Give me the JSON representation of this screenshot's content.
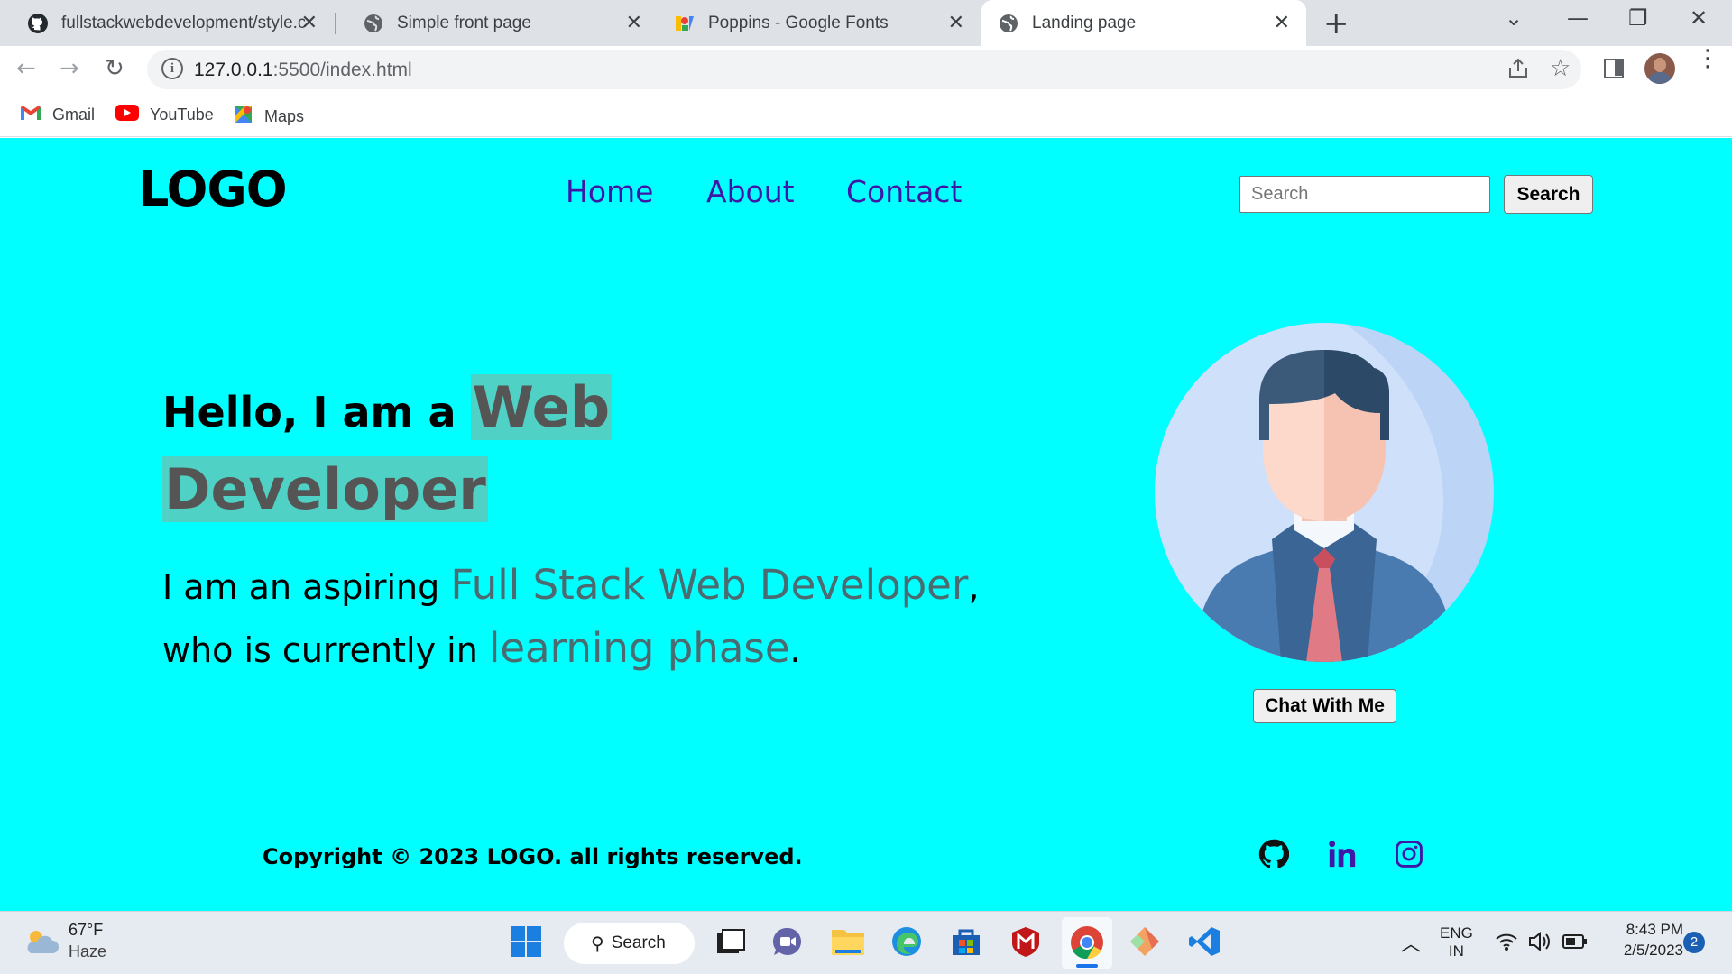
{
  "browser": {
    "tabs": [
      {
        "title": "fullstackwebdevelopment/style.c",
        "icon": "github-icon"
      },
      {
        "title": "Simple front page",
        "icon": "globe-icon"
      },
      {
        "title": "Poppins - Google Fonts",
        "icon": "google-fonts-icon"
      },
      {
        "title": "Landing page",
        "icon": "globe-icon",
        "active": true
      }
    ],
    "url_host": "127.0.0.1",
    "url_rest": ":5500/index.html",
    "bookmarks": [
      {
        "label": "Gmail",
        "icon": "gmail-icon"
      },
      {
        "label": "YouTube",
        "icon": "youtube-icon"
      },
      {
        "label": "Maps",
        "icon": "maps-icon"
      }
    ]
  },
  "site": {
    "logo": "LOGO",
    "nav": [
      "Home",
      "About",
      "Contact"
    ],
    "search_placeholder": "Search",
    "search_button": "Search",
    "hero": {
      "prefix": "Hello, I am a ",
      "highlight_1": "Web",
      "highlight_2": "Developer",
      "desc_1": "I am an aspiring ",
      "desc_em_1": "Full Stack Web Developer",
      "desc_2": ",",
      "desc_3": "who is currently in ",
      "desc_em_2": "learning phase",
      "desc_4": "."
    },
    "chat_button": "Chat With Me",
    "copyright": "Copyright © 2023 LOGO. all rights reserved.",
    "social": [
      "github-icon",
      "linkedin-icon",
      "instagram-icon"
    ],
    "colors": {
      "background": "#00ffff",
      "nav": "#3f18a8",
      "highlight": "#4fd1c5"
    }
  },
  "taskbar": {
    "weather_temp": "67°F",
    "weather_desc": "Haze",
    "search_label": "Search",
    "lang_1": "ENG",
    "lang_2": "IN",
    "time": "8:43 PM",
    "date": "2/5/2023",
    "notifications": "2"
  }
}
